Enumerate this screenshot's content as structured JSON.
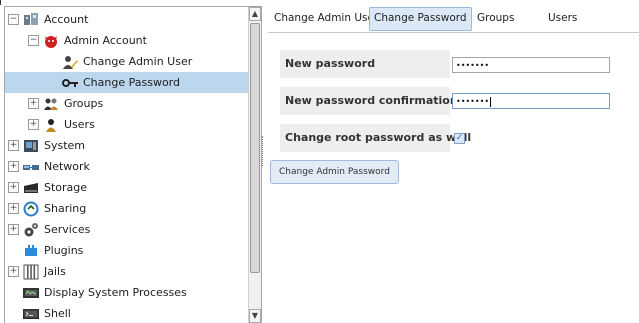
{
  "tree": {
    "items": [
      {
        "label": "Account",
        "icon": "users-group-icon",
        "expander": "−"
      },
      {
        "label": "Admin Account",
        "icon": "admin-devil-icon",
        "expander": "−"
      },
      {
        "label": "Change Admin User",
        "icon": "user-edit-icon",
        "expander": ""
      },
      {
        "label": "Change Password",
        "icon": "key-icon",
        "expander": ""
      },
      {
        "label": "Groups",
        "icon": "group-icon",
        "expander": "+"
      },
      {
        "label": "Users",
        "icon": "user-icon",
        "expander": "+"
      },
      {
        "label": "System",
        "icon": "system-icon",
        "expander": "+"
      },
      {
        "label": "Network",
        "icon": "network-icon",
        "expander": "+"
      },
      {
        "label": "Storage",
        "icon": "storage-icon",
        "expander": "+"
      },
      {
        "label": "Sharing",
        "icon": "sharing-icon",
        "expander": "+"
      },
      {
        "label": "Services",
        "icon": "services-icon",
        "expander": "+"
      },
      {
        "label": "Plugins",
        "icon": "plugins-icon",
        "expander": ""
      },
      {
        "label": "Jails",
        "icon": "jails-icon",
        "expander": "+"
      },
      {
        "label": "Display System Processes",
        "icon": "processes-icon",
        "expander": ""
      },
      {
        "label": "Shell",
        "icon": "shell-icon",
        "expander": ""
      }
    ],
    "selected_index": 3
  },
  "tabs": [
    {
      "label": "Change Admin User"
    },
    {
      "label": "Change Password"
    },
    {
      "label": "Groups"
    },
    {
      "label": "Users"
    }
  ],
  "active_tab": 1,
  "form": {
    "new_password_label": "New password",
    "new_password_value": "•••••••",
    "confirm_label": "New password confirmation",
    "confirm_value": "•••••••",
    "root_label": "Change root password as well",
    "root_checked": true,
    "check_glyph": "✓",
    "submit_label": "Change Admin Password"
  },
  "scrollbar": {
    "up_glyph": "▲",
    "down_glyph": "▼"
  }
}
